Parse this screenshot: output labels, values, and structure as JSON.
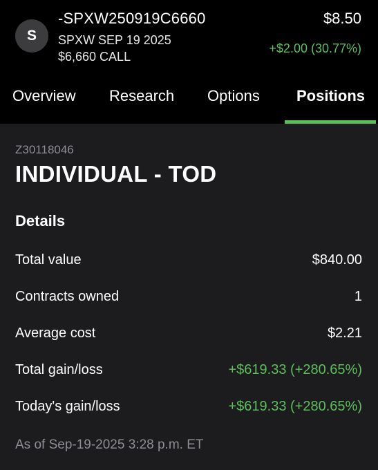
{
  "header": {
    "avatar_letter": "S",
    "symbol": "-SPXW250919C6660",
    "description_line1": "SPXW SEP 19 2025",
    "description_line2": "$6,660 CALL",
    "price": "$8.50",
    "change": "+$2.00 (30.77%)"
  },
  "tabs": [
    {
      "label": "Overview",
      "active": false
    },
    {
      "label": "Research",
      "active": false
    },
    {
      "label": "Options",
      "active": false
    },
    {
      "label": "Positions",
      "active": true
    }
  ],
  "account": {
    "number": "Z30118046",
    "name": "INDIVIDUAL - TOD"
  },
  "details": {
    "title": "Details",
    "rows": [
      {
        "label": "Total value",
        "value": "$840.00"
      },
      {
        "label": "Contracts owned",
        "value": "1"
      },
      {
        "label": "Average cost",
        "value": "$2.21"
      },
      {
        "label": "Total gain/loss",
        "value": "+$619.33 (+280.65%)"
      },
      {
        "label": "Today's gain/loss",
        "value": "+$619.33 (+280.65%)"
      }
    ],
    "as_of": "As of Sep-19-2025 3:28 p.m. ET"
  },
  "colors": {
    "gain": "#5cbf5c",
    "background": "#000000",
    "panel": "#1c1c1e",
    "muted": "#8e8e93"
  }
}
